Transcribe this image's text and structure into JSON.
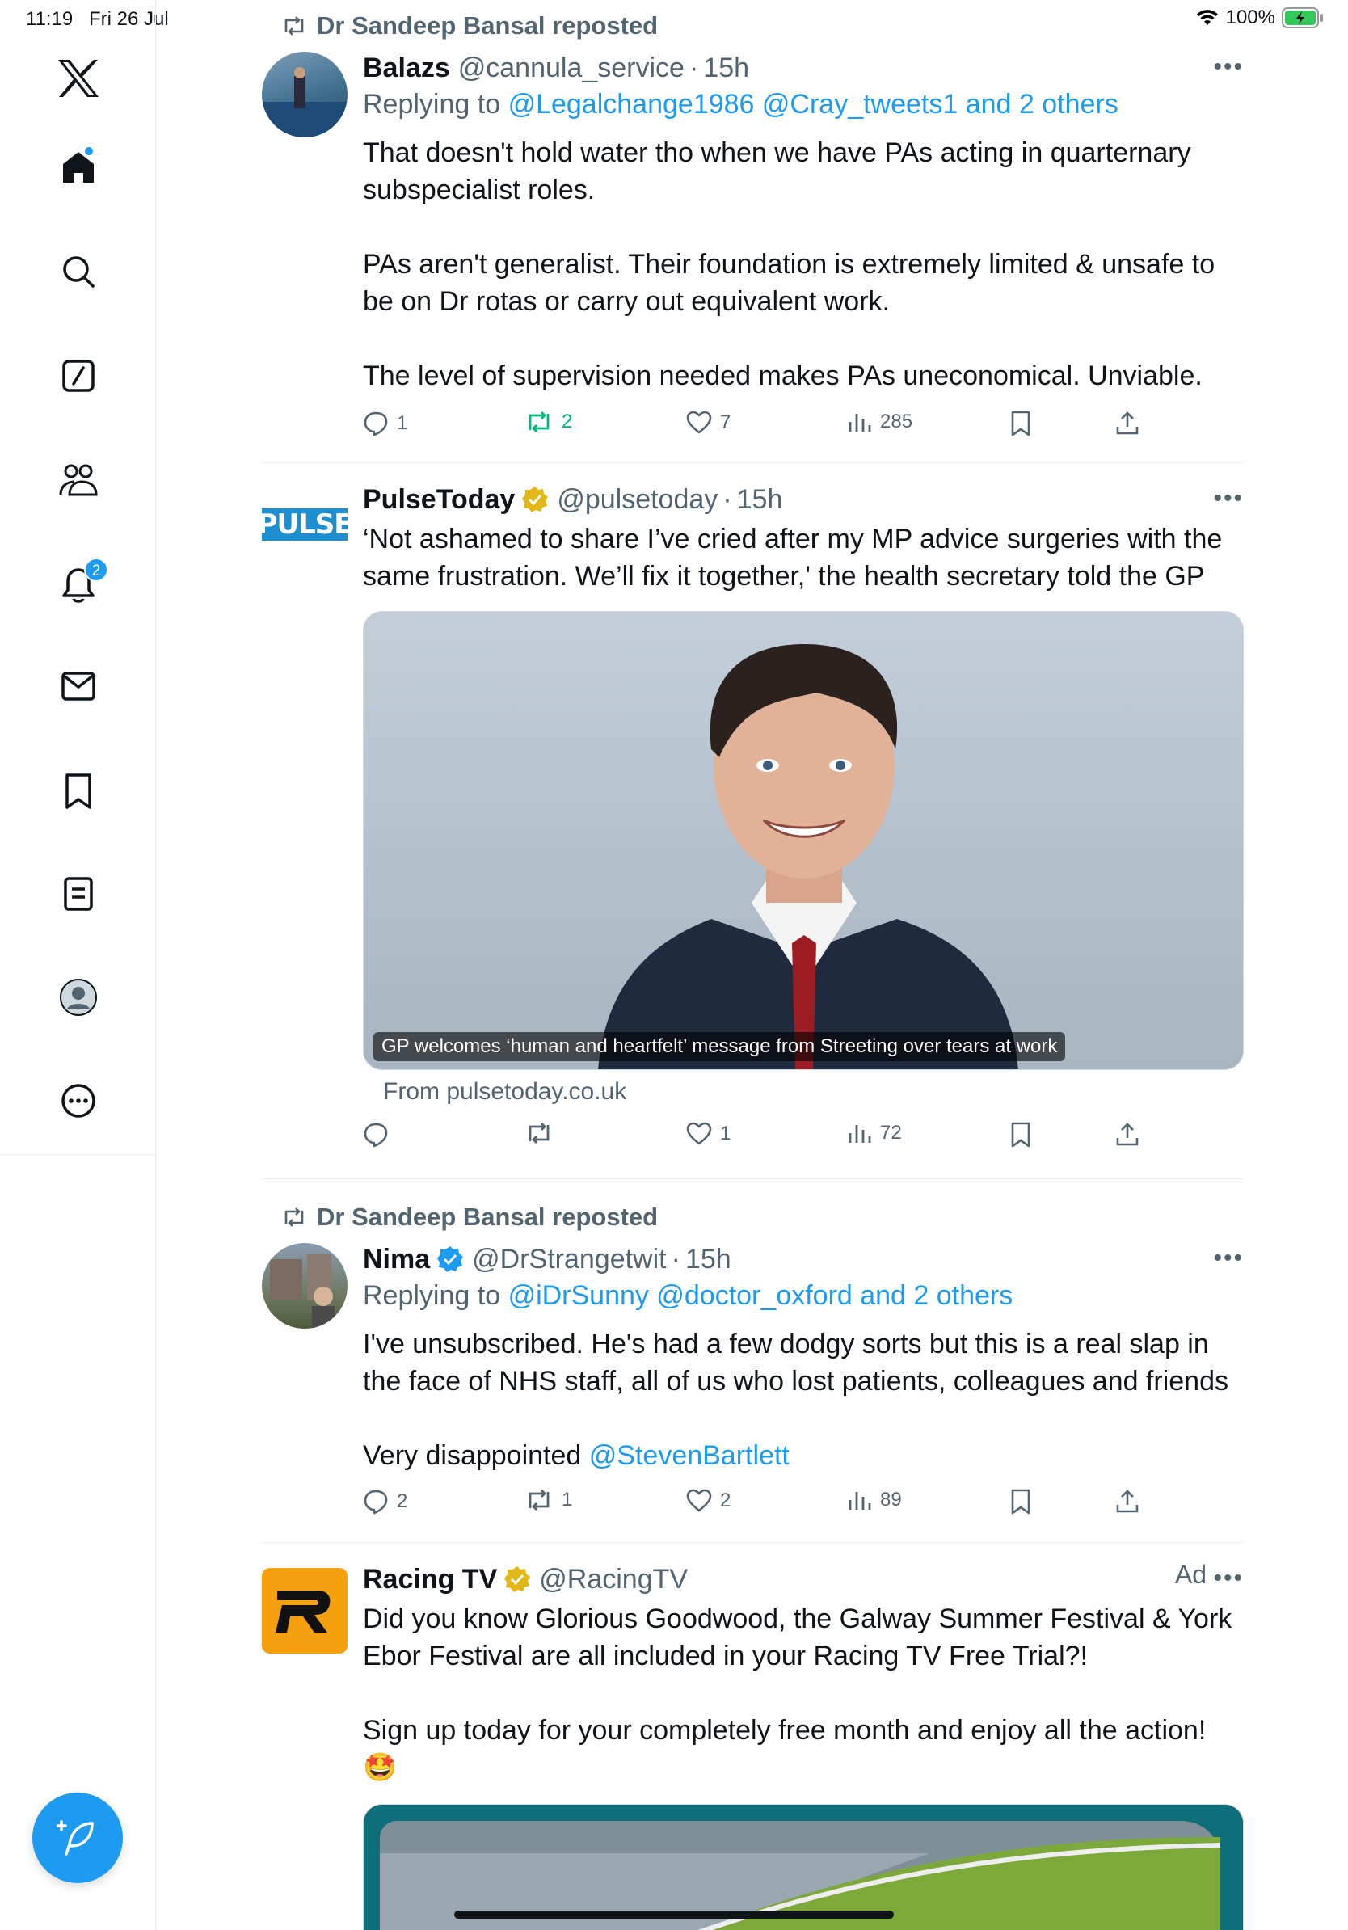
{
  "status_bar": {
    "time": "11:19",
    "date": "Fri 26 Jul",
    "battery": "100%"
  },
  "sidebar": {
    "items": [
      {
        "icon": "x-logo-icon"
      },
      {
        "icon": "home-icon"
      },
      {
        "icon": "search-icon"
      },
      {
        "icon": "grok-icon"
      },
      {
        "icon": "communities-icon"
      },
      {
        "icon": "notifications-icon",
        "badge": "2"
      },
      {
        "icon": "messages-icon"
      },
      {
        "icon": "bookmarks-icon"
      },
      {
        "icon": "lists-icon"
      },
      {
        "icon": "profile-icon"
      },
      {
        "icon": "more-icon"
      }
    ],
    "accent": "#1d9bf0"
  },
  "tweets": [
    {
      "repost_by": "Dr Sandeep Bansal reposted",
      "name": "Balazs",
      "handle": "@cannula_service",
      "time": "15h",
      "replying_prefix": "Replying to",
      "replying_to": "@Legalchange1986 @Cray_tweets1 and 2 others",
      "text": "That doesn't hold water tho when we have PAs acting in quarternary subspecialist roles.\n\nPAs aren't generalist. Their foundation is extremely limited & unsafe to be on Dr rotas or carry out equivalent work.\n\nThe level of supervision needed makes PAs uneconomical. Unviable.",
      "replies": "1",
      "reposts": "2",
      "likes": "7",
      "views": "285"
    },
    {
      "name": "PulseToday",
      "handle": "@pulsetoday",
      "time": "15h",
      "avatar_text": "PULSE",
      "text": "‘Not ashamed to share I’ve cried after my MP advice surgeries with the same frustration. We’ll fix it together,' the health secretary told the GP",
      "card_caption": "GP welcomes ‘human and heartfelt’ message from Streeting over tears at work",
      "card_from": "From pulsetoday.co.uk",
      "replies": "",
      "reposts": "",
      "likes": "1",
      "views": "72"
    },
    {
      "repost_by": "Dr Sandeep Bansal reposted",
      "name": "Nima",
      "handle": "@DrStrangetwit",
      "time": "15h",
      "replying_prefix": "Replying to",
      "replying_to": "@iDrSunny @doctor_oxford and 2 others",
      "text_main": "I've unsubscribed. He's had a few dodgy sorts but this is a real slap in the face of NHS staff, all of us who lost patients, colleagues and friends",
      "text_tail": "Very disappointed ",
      "mention": "@StevenBartlett",
      "replies": "2",
      "reposts": "1",
      "likes": "2",
      "views": "89"
    },
    {
      "name": "Racing TV",
      "handle": "@RacingTV",
      "ad_label": "Ad",
      "text": "Did you know Glorious Goodwood, the Galway Summer Festival & York Ebor Festival are all included in your Racing TV Free Trial?!\n\nSign up today for your completely free month and enjoy all the action!",
      "emoji": "🤩"
    }
  ]
}
